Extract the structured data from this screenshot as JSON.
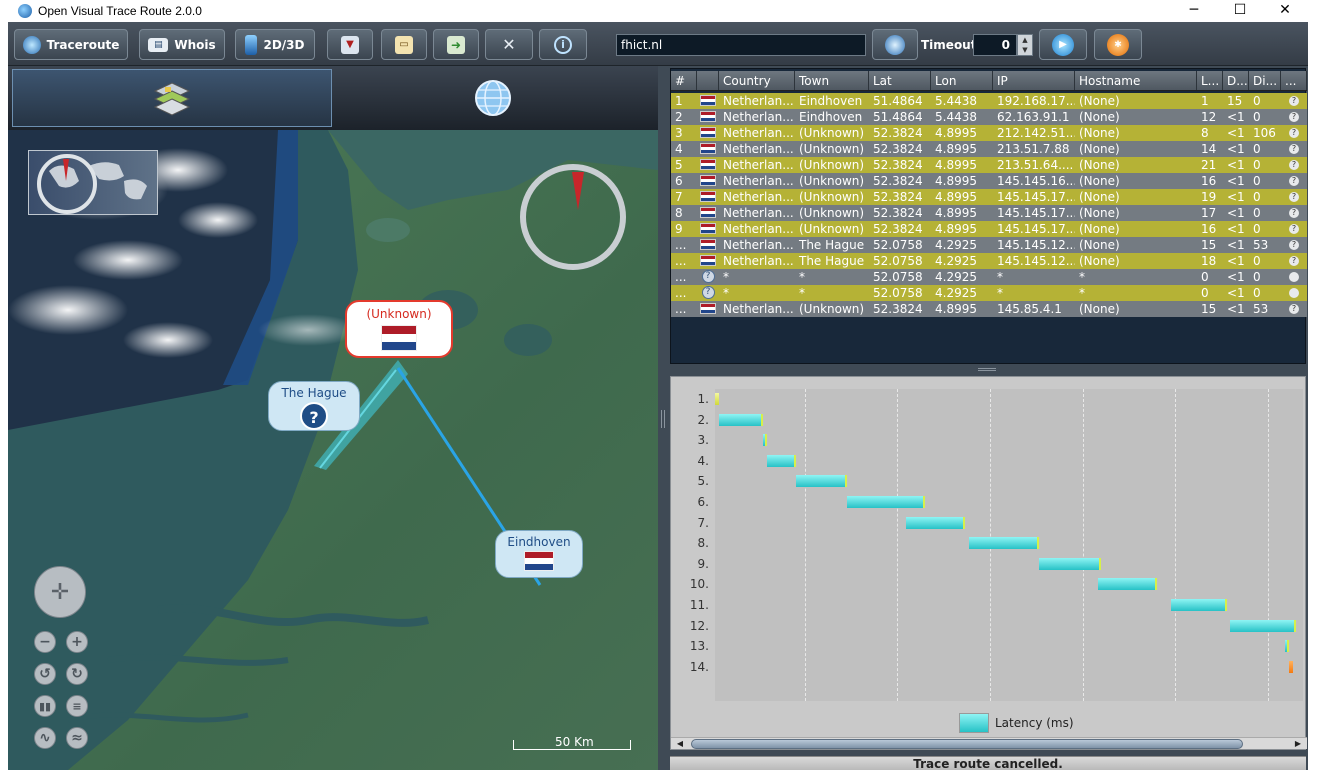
{
  "window": {
    "title": "Open Visual Trace Route 2.0.0",
    "minimize": "─",
    "maximize": "☐",
    "close": "✕"
  },
  "toolbar": {
    "traceroute_label": "Traceroute",
    "whois_label": "Whois",
    "toggle_3d_label": "2D/3D",
    "host_value": "fhict.nl",
    "timeout_label": "Timeout",
    "timeout_value": "0"
  },
  "map": {
    "callouts": [
      {
        "label": "(Unknown)",
        "icon": "netherlands-flag"
      },
      {
        "label": "The Hague",
        "icon": "unknown-question"
      },
      {
        "label": "Eindhoven",
        "icon": "netherlands-flag"
      }
    ],
    "scale_label": "50 Km",
    "route_color": "#2aa4e6"
  },
  "table": {
    "headers": [
      "#",
      "",
      "Country",
      "Town",
      "Lat",
      "Lon",
      "IP",
      "Hostname",
      "L...",
      "D...",
      "Di...",
      "..."
    ],
    "rows": [
      {
        "n": "1",
        "country": "Netherlan...",
        "town": "Eindhoven",
        "lat": "51.4864",
        "lon": "5.4438",
        "ip": "192.168.17...",
        "host": "(None)",
        "l": "1",
        "d": "15",
        "di": "0",
        "flag": "nl"
      },
      {
        "n": "2",
        "country": "Netherlan...",
        "town": "Eindhoven",
        "lat": "51.4864",
        "lon": "5.4438",
        "ip": "62.163.91.1",
        "host": "(None)",
        "l": "12",
        "d": "<1",
        "di": "0",
        "flag": "nl"
      },
      {
        "n": "3",
        "country": "Netherlan...",
        "town": "(Unknown)",
        "lat": "52.3824",
        "lon": "4.8995",
        "ip": "212.142.51...",
        "host": "(None)",
        "l": "8",
        "d": "<1",
        "di": "106",
        "flag": "nl"
      },
      {
        "n": "4",
        "country": "Netherlan...",
        "town": "(Unknown)",
        "lat": "52.3824",
        "lon": "4.8995",
        "ip": "213.51.7.88",
        "host": "(None)",
        "l": "14",
        "d": "<1",
        "di": "0",
        "flag": "nl"
      },
      {
        "n": "5",
        "country": "Netherlan...",
        "town": "(Unknown)",
        "lat": "52.3824",
        "lon": "4.8995",
        "ip": "213.51.64....",
        "host": "(None)",
        "l": "21",
        "d": "<1",
        "di": "0",
        "flag": "nl"
      },
      {
        "n": "6",
        "country": "Netherlan...",
        "town": "(Unknown)",
        "lat": "52.3824",
        "lon": "4.8995",
        "ip": "145.145.16...",
        "host": "(None)",
        "l": "16",
        "d": "<1",
        "di": "0",
        "flag": "nl"
      },
      {
        "n": "7",
        "country": "Netherlan...",
        "town": "(Unknown)",
        "lat": "52.3824",
        "lon": "4.8995",
        "ip": "145.145.17...",
        "host": "(None)",
        "l": "19",
        "d": "<1",
        "di": "0",
        "flag": "nl"
      },
      {
        "n": "8",
        "country": "Netherlan...",
        "town": "(Unknown)",
        "lat": "52.3824",
        "lon": "4.8995",
        "ip": "145.145.17...",
        "host": "(None)",
        "l": "17",
        "d": "<1",
        "di": "0",
        "flag": "nl"
      },
      {
        "n": "9",
        "country": "Netherlan...",
        "town": "(Unknown)",
        "lat": "52.3824",
        "lon": "4.8995",
        "ip": "145.145.17...",
        "host": "(None)",
        "l": "16",
        "d": "<1",
        "di": "0",
        "flag": "nl"
      },
      {
        "n": "...",
        "country": "Netherlan...",
        "town": "The Hague",
        "lat": "52.0758",
        "lon": "4.2925",
        "ip": "145.145.12...",
        "host": "(None)",
        "l": "15",
        "d": "<1",
        "di": "53",
        "flag": "nl"
      },
      {
        "n": "...",
        "country": "Netherlan...",
        "town": "The Hague",
        "lat": "52.0758",
        "lon": "4.2925",
        "ip": "145.145.12...",
        "host": "(None)",
        "l": "18",
        "d": "<1",
        "di": "0",
        "flag": "nl"
      },
      {
        "n": "...",
        "country": "*",
        "town": "*",
        "lat": "52.0758",
        "lon": "4.2925",
        "ip": "*",
        "host": "*",
        "l": "0",
        "d": "<1",
        "di": "0",
        "flag": "unknown"
      },
      {
        "n": "...",
        "country": "*",
        "town": "*",
        "lat": "52.0758",
        "lon": "4.2925",
        "ip": "*",
        "host": "*",
        "l": "0",
        "d": "<1",
        "di": "0",
        "flag": "unknown"
      },
      {
        "n": "...",
        "country": "Netherlan...",
        "town": "(Unknown)",
        "lat": "52.3824",
        "lon": "4.8995",
        "ip": "145.85.4.1",
        "host": "(None)",
        "l": "15",
        "d": "<1",
        "di": "53",
        "flag": "nl"
      }
    ]
  },
  "chart_data": {
    "type": "bar",
    "categories": [
      "1.",
      "2.",
      "3.",
      "4.",
      "5.",
      "6.",
      "7.",
      "8.",
      "9.",
      "10.",
      "11.",
      "12.",
      "13.",
      "14."
    ],
    "series": [
      {
        "name": "Latency (ms)",
        "start": [
          0,
          1,
          13,
          14,
          22,
          36,
          52,
          69,
          88,
          104,
          124,
          140,
          155,
          156
        ],
        "values": [
          1,
          12,
          1,
          8,
          14,
          21,
          16,
          19,
          17,
          16,
          15,
          18,
          0,
          0
        ],
        "colors": [
          "yellow",
          "cyan",
          "cyan",
          "cyan",
          "cyan",
          "cyan",
          "cyan",
          "cyan",
          "cyan",
          "cyan",
          "cyan",
          "cyan",
          "cyan",
          "orange"
        ]
      }
    ],
    "xlabel": "",
    "ylabel": "",
    "legend": "bottom",
    "grid": true
  },
  "status": {
    "text": "Trace route cancelled."
  }
}
